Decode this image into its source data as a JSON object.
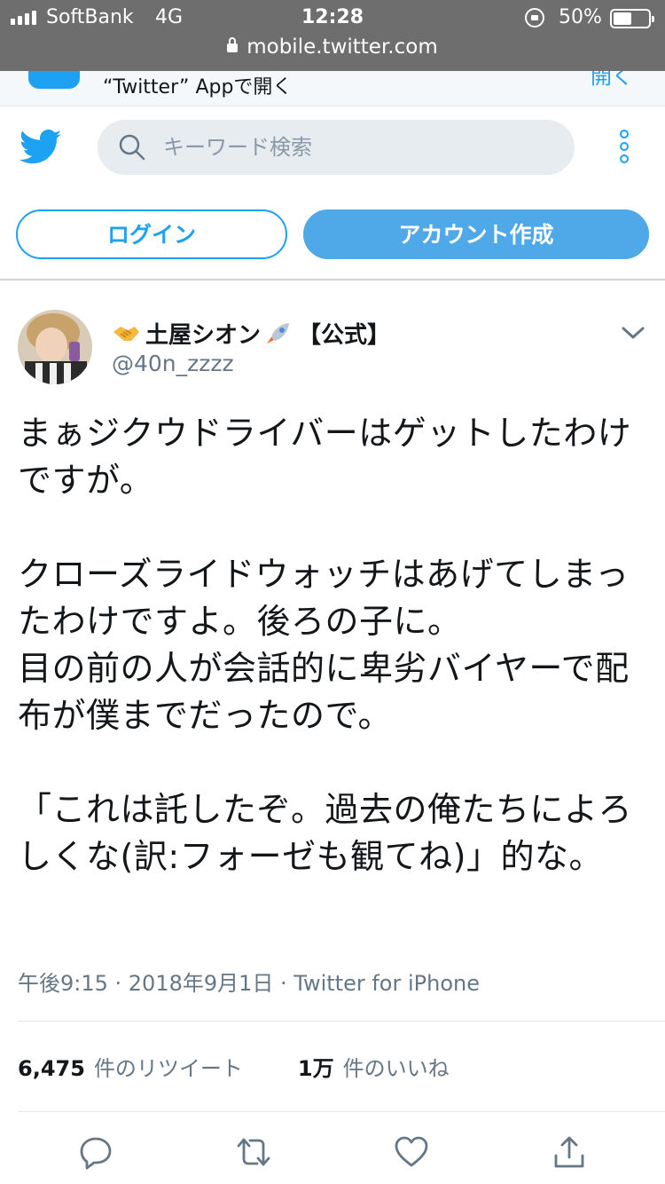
{
  "status_bar": {
    "carrier": "SoftBank",
    "network": "4G",
    "time": "12:28",
    "battery": "50%"
  },
  "url_bar": {
    "url": "mobile.twitter.com"
  },
  "app_banner": {
    "text": "“Twitter” Appで開く",
    "open_label": "開く"
  },
  "header": {
    "search_placeholder": "キーワード検索"
  },
  "auth": {
    "login_label": "ログイン",
    "signup_label": "アカウント作成"
  },
  "tweet": {
    "display_name": "土屋シオン",
    "name_suffix": "【公式】",
    "handle": "@40n_zzzz",
    "text": "まぁジクウドライバーはゲットしたわけですが。\n\nクローズライドウォッチはあげてしまったわけですよ。後ろの子に。\n目の前の人が会話的に卑劣バイヤーで配布が僕までだったので。\n\n「これは託したぞ。過去の俺たちによろしくな(訳:フォーゼも観てね)」的な。",
    "meta": "午後9:15 · 2018年9月1日 · Twitter for iPhone",
    "retweets": {
      "count": "6,475",
      "label": "件のリツイート"
    },
    "likes": {
      "count": "1万",
      "label": "件のいいね"
    }
  },
  "colors": {
    "brand": "#1da1f2",
    "secondary_text": "#657786"
  },
  "icons": [
    "twitter-bird-icon",
    "search-icon",
    "more-icon",
    "chevron-down-icon",
    "reply-icon",
    "retweet-icon",
    "like-icon",
    "share-icon"
  ]
}
